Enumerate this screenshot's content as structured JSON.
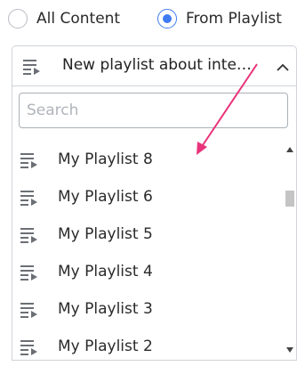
{
  "radio_group": {
    "options": [
      {
        "label": "All Content",
        "checked": false
      },
      {
        "label": "From Playlist",
        "checked": true
      }
    ],
    "accent_color": "#3f7bf2"
  },
  "playlist_select": {
    "selected_label": "New playlist about inte…",
    "expanded": true,
    "icon": "playlist-icon",
    "chevron": "chevron-up-icon"
  },
  "dropdown": {
    "search_placeholder": "Search",
    "search_value": "",
    "items": [
      {
        "label": "My Playlist 8",
        "icon": "playlist-icon"
      },
      {
        "label": "My Playlist 6",
        "icon": "playlist-icon"
      },
      {
        "label": "My Playlist 5",
        "icon": "playlist-icon"
      },
      {
        "label": "My Playlist 4",
        "icon": "playlist-icon"
      },
      {
        "label": "My Playlist 3",
        "icon": "playlist-icon"
      },
      {
        "label": "My Playlist 2",
        "icon": "playlist-icon"
      }
    ]
  },
  "annotation": {
    "arrow_color": "#e8337a"
  }
}
